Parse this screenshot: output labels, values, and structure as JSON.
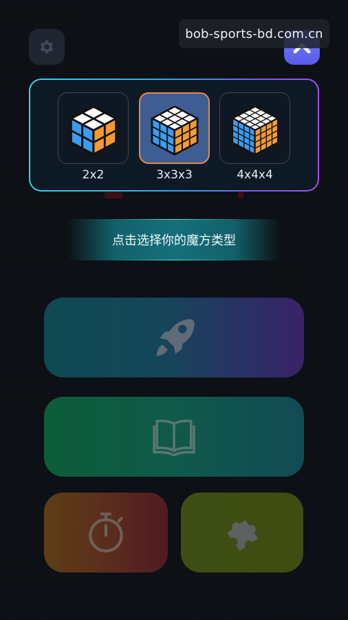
{
  "watermark": {
    "text": "bob-sports-bd.com.cn"
  },
  "top_bar": {
    "settings_icon": "gear-icon",
    "collapse_icon": "chevron-up-icon"
  },
  "cube_selector": {
    "options": [
      {
        "label": "2x2",
        "grid": 2,
        "selected": false
      },
      {
        "label": "3x3x3",
        "grid": 3,
        "selected": true
      },
      {
        "label": "4x4x4",
        "grid": 4,
        "selected": false
      }
    ]
  },
  "prompt": {
    "text": "点击选择你的魔方类型"
  },
  "tiles": {
    "speed": {
      "icon": "rocket-icon"
    },
    "learn": {
      "icon": "book-icon"
    },
    "timer": {
      "icon": "stopwatch-icon"
    },
    "puzzle": {
      "icon": "puzzle-icon"
    }
  },
  "colors": {
    "cube_top": "#ffffff",
    "cube_left": "#3a9cf0",
    "cube_right": "#f59a2f",
    "panel_border_start": "#39d3ea",
    "panel_border_end": "#a74df0",
    "selected_outline": "#e88a4c",
    "accent": "#5b5bea"
  }
}
